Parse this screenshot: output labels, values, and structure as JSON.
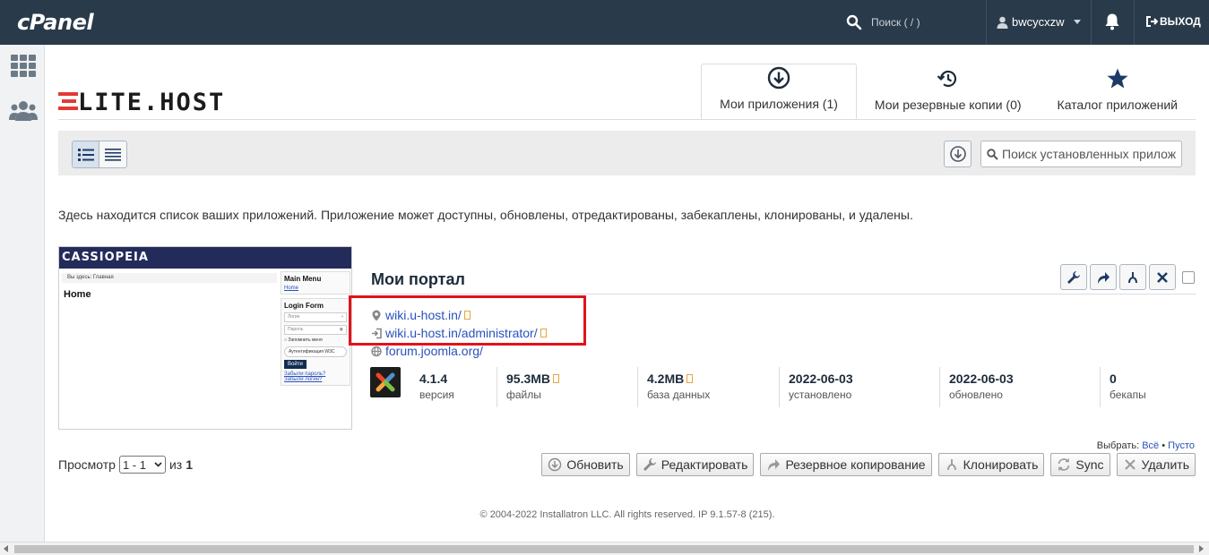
{
  "topbar": {
    "logo": "cPanel",
    "search_placeholder": "Поиск ( / )",
    "username": "bwcycxzw",
    "logout_label": "ВЫХОД"
  },
  "brand": {
    "name": "LITE.HOST"
  },
  "tabs": [
    {
      "label": "Мои приложения (1)",
      "icon": "download-circle-icon",
      "active": true
    },
    {
      "label": "Мои резервные копии (0)",
      "icon": "history-icon",
      "active": false
    },
    {
      "label": "Каталог приложений",
      "icon": "star-icon",
      "active": false
    }
  ],
  "toolbar": {
    "search_placeholder": "Поиск установленных прилож"
  },
  "description": "Здесь находится список ваших приложений. Приложение может доступны, обновлены, отредактированы, забекаплены, клонированы, и удалены.",
  "thumbnail": {
    "site_name": "CASSIOPEIA",
    "breadcrumb": "Вы здесь:  Главная",
    "heading": "Home",
    "main_menu_title": "Main Menu",
    "main_menu_link": "Home",
    "login_title": "Login Form",
    "login_field": "Логин",
    "password_field": "Пароль",
    "remember": "Запомнить меня",
    "auth_label": "Аутентификация W3C",
    "login_button": "Войти",
    "forgot1": "Забыли пароль?",
    "forgot2": "Забыли логин?"
  },
  "app": {
    "title": "Мои портал",
    "links": {
      "site": "wiki.u-host.in/",
      "admin": "wiki.u-host.in/administrator/",
      "forum": "forum.joomla.org/"
    },
    "stats": [
      {
        "value": "4.1.4",
        "label": "версия"
      },
      {
        "value": "95.3MB",
        "label": "файлы"
      },
      {
        "value": "4.2MB",
        "label": "база данных"
      },
      {
        "value": "2022-06-03",
        "label": "установлено"
      },
      {
        "value": "2022-06-03",
        "label": "обновлено"
      },
      {
        "value": "0",
        "label": "бекапы"
      }
    ]
  },
  "select": {
    "label": "Выбрать:",
    "all": "Всё",
    "dot": "•",
    "none": "Пусто"
  },
  "pager": {
    "label": "Просмотр",
    "range": "1 - 1",
    "of": "из",
    "total": "1"
  },
  "bulk": {
    "update": "Обновить",
    "edit": "Редактировать",
    "backup": "Резервное копирование",
    "clone": "Клонировать",
    "sync": "Sync",
    "delete": "Удалить"
  },
  "footer": "© 2004-2022 Installatron LLC. All rights reserved. IP 9.1.57-8 (215).",
  "colors": {
    "topbar": "#293a4a",
    "link": "#2a52be",
    "highlight": "#e1131b",
    "brand_red": "#e53935"
  }
}
